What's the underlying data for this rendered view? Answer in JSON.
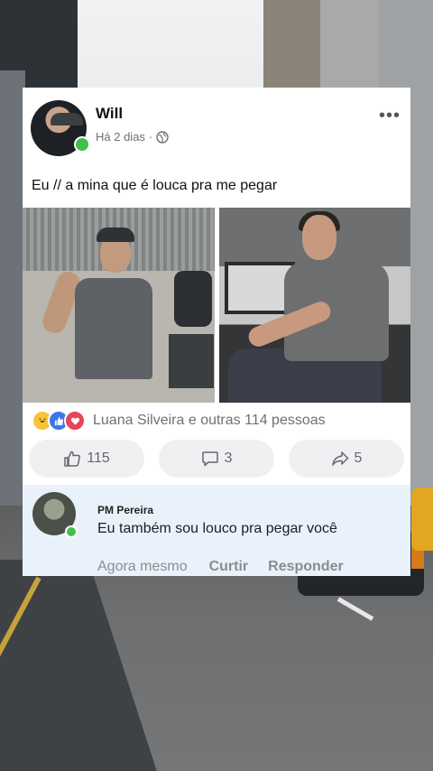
{
  "post": {
    "author": "Will",
    "time": "Há 2 dias",
    "separator": "·",
    "privacy_icon": "globe-icon",
    "more_icon": "more-dots-icon",
    "more_label": "•••",
    "text": "Eu // a mina que é louca pra me pegar"
  },
  "reactions": {
    "icons": [
      "haha-icon",
      "like-icon",
      "love-icon"
    ],
    "summary": "Luana Silveira e outras 114 pessoas"
  },
  "actions": {
    "like_count": "115",
    "comment_count": "3",
    "share_count": "5"
  },
  "comment": {
    "author": "PM Pereira",
    "text": "Eu também sou louco pra pegar você",
    "time": "Agora mesmo",
    "like_label": "Curtir",
    "reply_label": "Responder"
  },
  "colors": {
    "online": "#3fc04d",
    "comment_bg": "#e9f2fb",
    "action_bg": "#eef0f2",
    "muted_text": "#8a8d91"
  }
}
